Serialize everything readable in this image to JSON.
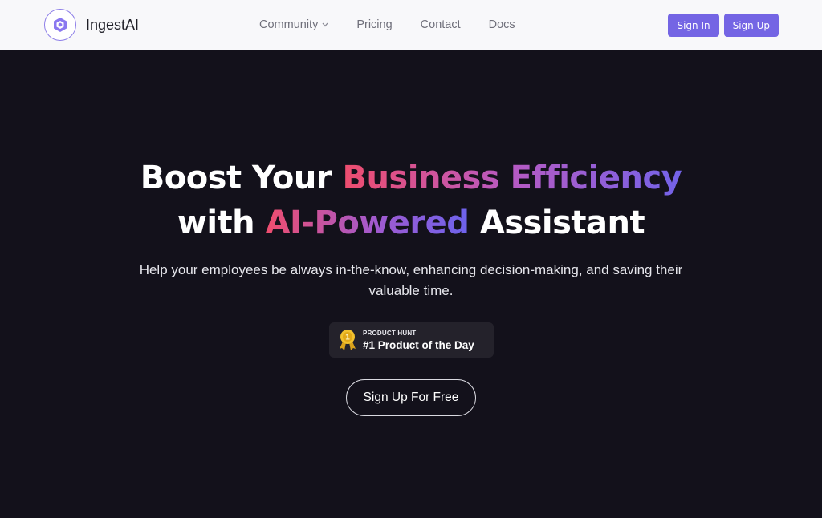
{
  "brand": {
    "name": "IngestAI",
    "logo_icon": "hexagon-logo-icon"
  },
  "nav": {
    "items": [
      {
        "label": "Community",
        "has_dropdown": true
      },
      {
        "label": "Pricing"
      },
      {
        "label": "Contact"
      },
      {
        "label": "Docs"
      }
    ]
  },
  "auth": {
    "sign_in": "Sign In",
    "sign_up": "Sign Up"
  },
  "hero": {
    "headline_line1_plain": "Boost Your",
    "headline_line1_highlight": "Business Efficiency",
    "headline_line2_plain_start": "with",
    "headline_line2_highlight": "AI-Powered",
    "headline_line2_plain_end": "Assistant",
    "subtext": "Help your employees be always in-the-know, enhancing decision-making, and saving their valuable time.",
    "badge": {
      "kicker": "PRODUCT HUNT",
      "title": "#1 Product of the Day",
      "icon": "medal-icon"
    },
    "cta": "Sign Up For Free"
  },
  "colors": {
    "accent": "#7465e4",
    "background": "#13111b",
    "topbar": "#f8f8fa",
    "gradient_start": "#ee4d6e",
    "gradient_end": "#7363e9"
  }
}
